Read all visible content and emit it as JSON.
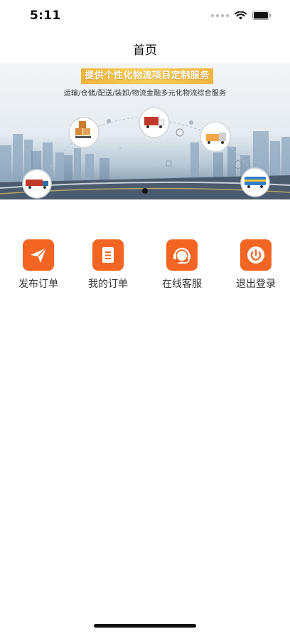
{
  "status_bar": {
    "time": "5:11"
  },
  "nav": {
    "title": "首页"
  },
  "banner": {
    "headline": "提供个性化物流项目定制服务",
    "subtitle": "运输/仓储/配送/装卸/物流金融多元化物流综合服务",
    "active_slide": 1
  },
  "menu": {
    "items": [
      {
        "label": "发布订单",
        "icon": "paper-plane-icon"
      },
      {
        "label": "我的订单",
        "icon": "document-icon"
      },
      {
        "label": "在线客服",
        "icon": "headset-icon"
      },
      {
        "label": "退出登录",
        "icon": "power-icon"
      }
    ]
  },
  "colors": {
    "accent": "#f26522",
    "headline_banner": "#f4be47"
  }
}
